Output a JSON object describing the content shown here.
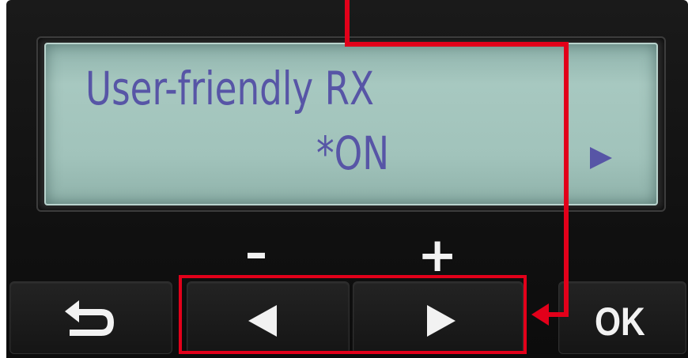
{
  "display": {
    "line1": "User-friendly RX",
    "line2": "*ON",
    "next_indicator_icon": "right-triangle-icon"
  },
  "keypad": {
    "minus_label": "–",
    "plus_label": "+",
    "back_icon": "return-arrow-icon",
    "left_icon": "left-triangle-icon",
    "right_icon": "right-triangle-icon",
    "ok_label": "OK"
  },
  "annotation": {
    "color": "#e2001a"
  },
  "colors": {
    "lcd_text": "#5755a6",
    "lcd_background": "#a1c3bb",
    "panel": "#151515"
  }
}
